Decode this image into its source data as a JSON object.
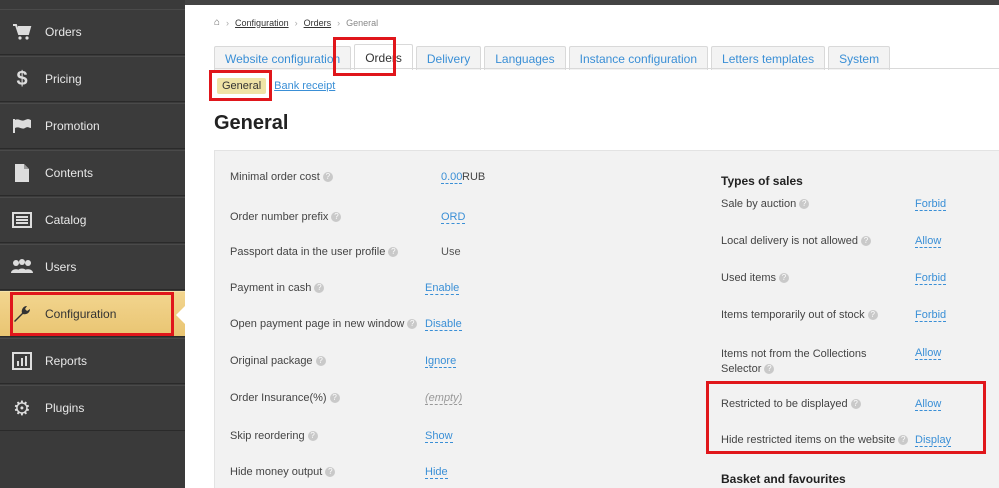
{
  "sidebar": {
    "items": [
      {
        "label": "Orders",
        "icon": "cart-icon"
      },
      {
        "label": "Pricing",
        "icon": "dollar-icon"
      },
      {
        "label": "Promotion",
        "icon": "flag-icon"
      },
      {
        "label": "Contents",
        "icon": "document-icon"
      },
      {
        "label": "Catalog",
        "icon": "list-icon"
      },
      {
        "label": "Users",
        "icon": "users-icon"
      },
      {
        "label": "Configuration",
        "icon": "wrench-icon"
      },
      {
        "label": "Reports",
        "icon": "chart-icon"
      },
      {
        "label": "Plugins",
        "icon": "gear-icon"
      }
    ],
    "active": "Configuration"
  },
  "breadcrumb": {
    "home_icon": "home-icon",
    "items": [
      "Configuration",
      "Orders",
      "General"
    ]
  },
  "tabs": [
    "Website configuration",
    "Orders",
    "Delivery",
    "Languages",
    "Instance configuration",
    "Letters templates",
    "System"
  ],
  "active_tab": "Orders",
  "subtabs": {
    "general": "General",
    "bank_receipt": "Bank receipt"
  },
  "page_title": "General",
  "left_settings": [
    {
      "label": "Minimal order cost",
      "value": "0.00",
      "suffix": " RUB"
    },
    {
      "label": "Order number prefix",
      "value": "ORD"
    },
    {
      "label": "Passport data in the user profile",
      "value": "Use"
    },
    {
      "label": "Payment in cash",
      "value": "Enable"
    },
    {
      "label": "Open payment page in new window",
      "value": "Disable"
    },
    {
      "label": "Original package",
      "value": "Ignore"
    },
    {
      "label": "Order Insurance(%)",
      "value": "(empty)"
    },
    {
      "label": "Skip reordering",
      "value": "Show"
    },
    {
      "label": "Hide money output",
      "value": "Hide"
    }
  ],
  "right_section_title": "Types of sales",
  "right_settings": [
    {
      "label": "Sale by auction",
      "value": "Forbid"
    },
    {
      "label": "Local delivery is not allowed",
      "value": "Allow"
    },
    {
      "label": "Used items",
      "value": "Forbid"
    },
    {
      "label": "Items temporarily out of stock",
      "value": "Forbid"
    },
    {
      "label": "Items not from the Collections Selector",
      "value": "Allow"
    },
    {
      "label": "Restricted to be displayed",
      "value": "Allow"
    },
    {
      "label": "Hide restricted items on the website",
      "value": "Display"
    }
  ],
  "right_section2_title": "Basket and favourites",
  "colors": {
    "sidebar_bg": "#3b3b3b",
    "active_item": "#e9c572",
    "link": "#3a8fd6",
    "highlight": "#e0161b"
  }
}
